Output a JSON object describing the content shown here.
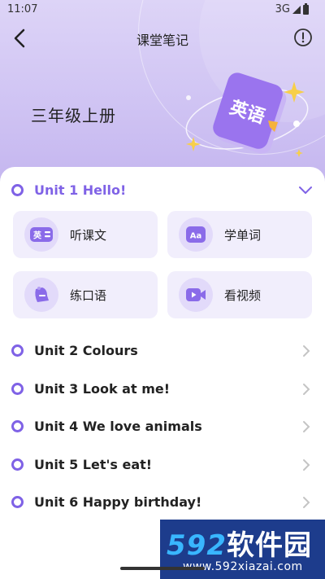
{
  "status_bar": {
    "time": "11:07",
    "network": "3G"
  },
  "header": {
    "title": "课堂笔记",
    "grade": "三年级上册",
    "book_badge": "英语"
  },
  "units": [
    {
      "label": "Unit 1 Hello!",
      "expanded": true
    },
    {
      "label": "Unit 2 Colours"
    },
    {
      "label": "Unit 3 Look at me!"
    },
    {
      "label": "Unit 4 We love animals"
    },
    {
      "label": "Unit 5 Let's eat!"
    },
    {
      "label": "Unit 6 Happy birthday!"
    }
  ],
  "activities": [
    {
      "label": "听课文",
      "icon": "textbook-icon",
      "icon_text": "英"
    },
    {
      "label": "学单词",
      "icon": "word-icon",
      "icon_text": "Aa"
    },
    {
      "label": "练口语",
      "icon": "speaking-icon"
    },
    {
      "label": "看视频",
      "icon": "video-icon"
    }
  ],
  "watermark": {
    "brand_num": "592",
    "brand_text": "软件园",
    "url": "www.592xiazai.com"
  },
  "colors": {
    "accent": "#7f62e6",
    "tile_bg": "#f1eefc",
    "icon_bg": "#e2dafa",
    "hero": "#cfc3f3"
  }
}
